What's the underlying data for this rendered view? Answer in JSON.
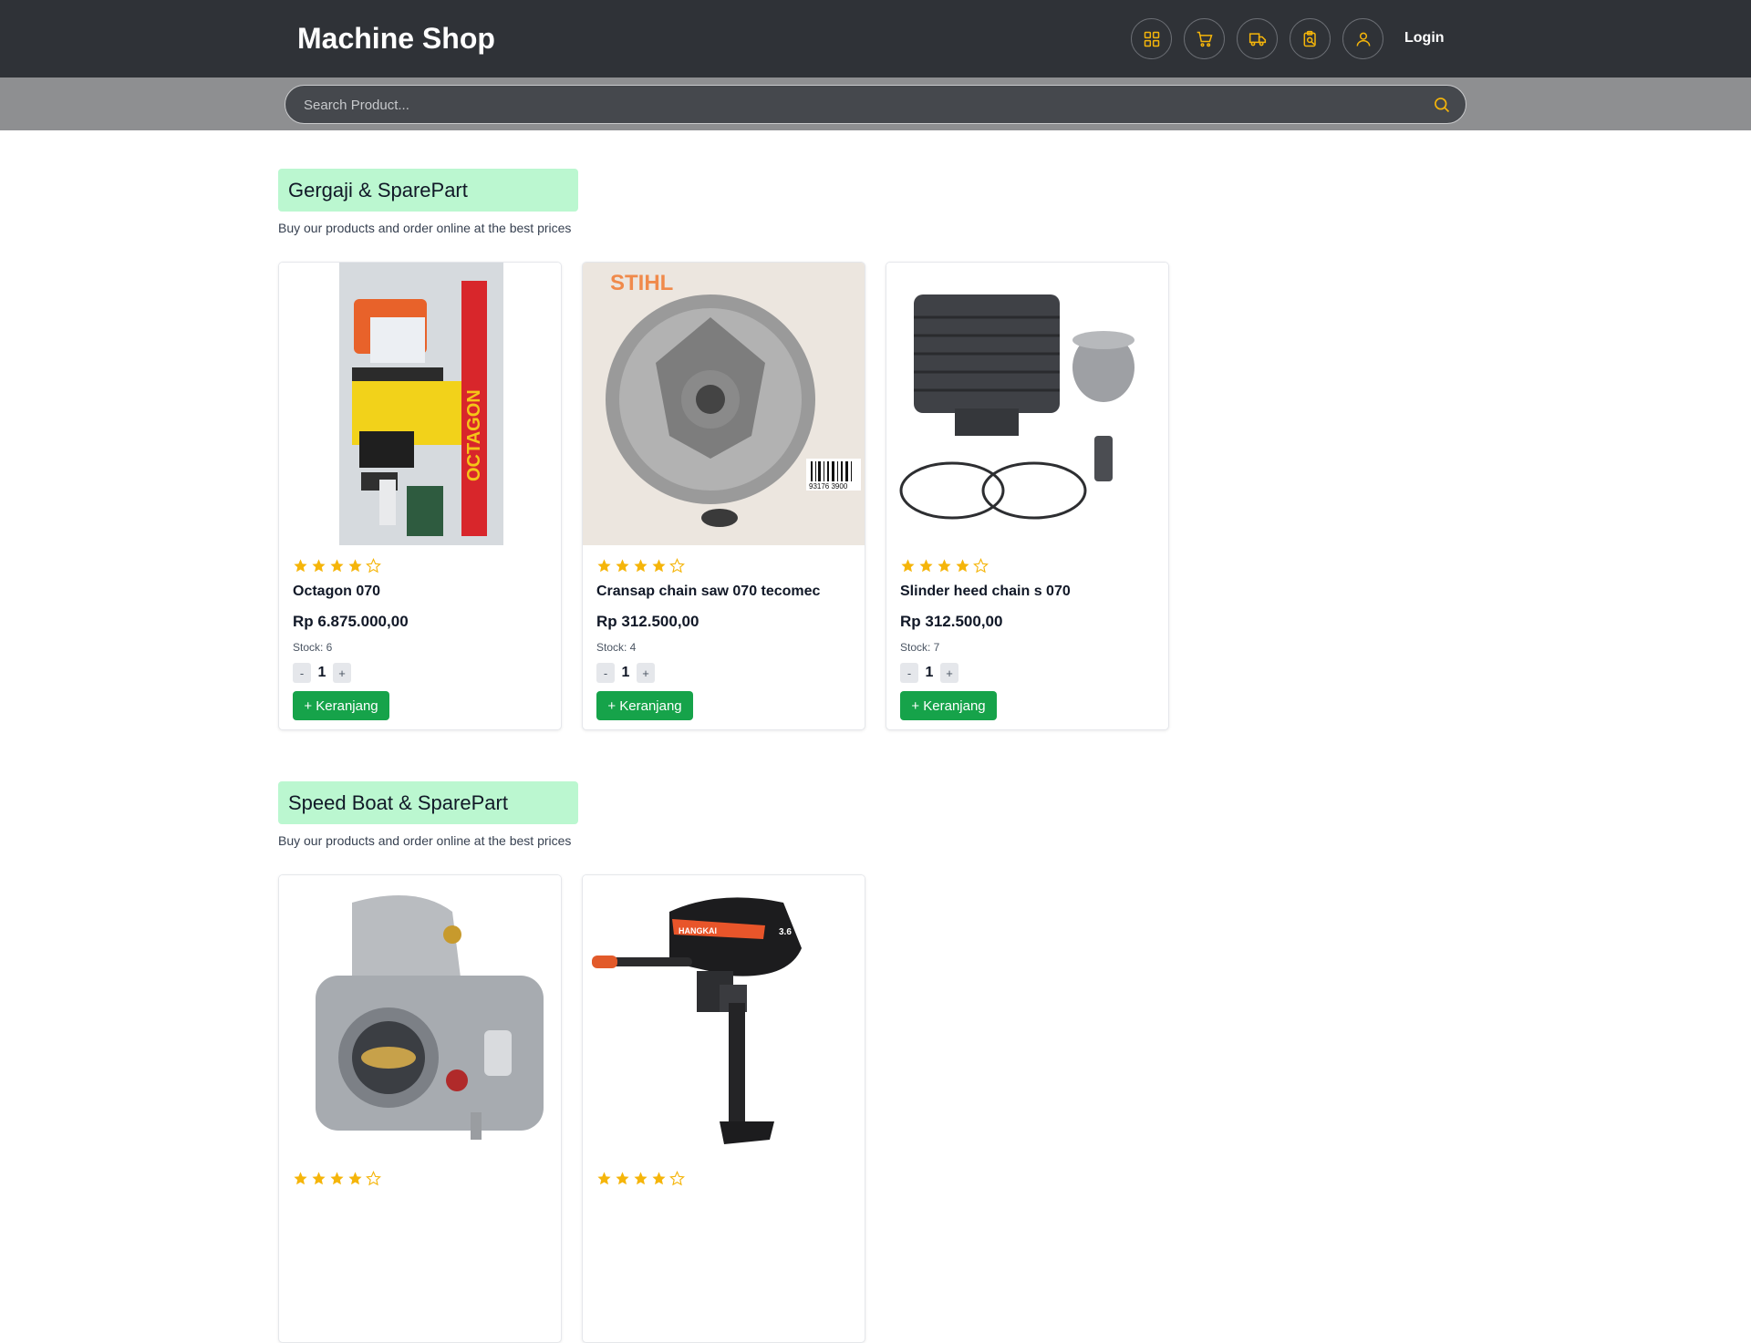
{
  "header": {
    "brand": "Machine Shop",
    "login_label": "Login",
    "nav_icons": [
      "grid-icon",
      "cart-icon",
      "truck-icon",
      "clipboard-search-icon",
      "user-icon"
    ],
    "accent_color": "#f5b50a"
  },
  "search": {
    "placeholder": "Search Product..."
  },
  "sections": [
    {
      "title": "Gergaji & SparePart",
      "subtitle": "Buy our products and order online at the best prices",
      "products": [
        {
          "name": "Octagon 070",
          "price": "Rp 6.875.000,00",
          "stock": "Stock: 6",
          "qty": "1",
          "rating": 4,
          "cart_label": "+ Keranjang",
          "minus": "-",
          "plus": "+"
        },
        {
          "name": "Cransap chain saw 070 tecomec",
          "price": "Rp 312.500,00",
          "stock": "Stock: 4",
          "qty": "1",
          "rating": 4,
          "cart_label": "+ Keranjang",
          "minus": "-",
          "plus": "+"
        },
        {
          "name": "Slinder heed chain s 070",
          "price": "Rp 312.500,00",
          "stock": "Stock: 7",
          "qty": "1",
          "rating": 4,
          "cart_label": "+ Keranjang",
          "minus": "-",
          "plus": "+"
        }
      ]
    },
    {
      "title": "Speed Boat & SparePart",
      "subtitle": "Buy our products and order online at the best prices",
      "products": [
        {
          "rating": 4
        },
        {
          "rating": 4
        }
      ]
    }
  ],
  "image_labels": {
    "octagon_box": "OCTAGON",
    "stihl": "STIHL",
    "barcode": "93176 3900",
    "motor_brand": "HANGKAI",
    "motor_hp": "3.6"
  }
}
